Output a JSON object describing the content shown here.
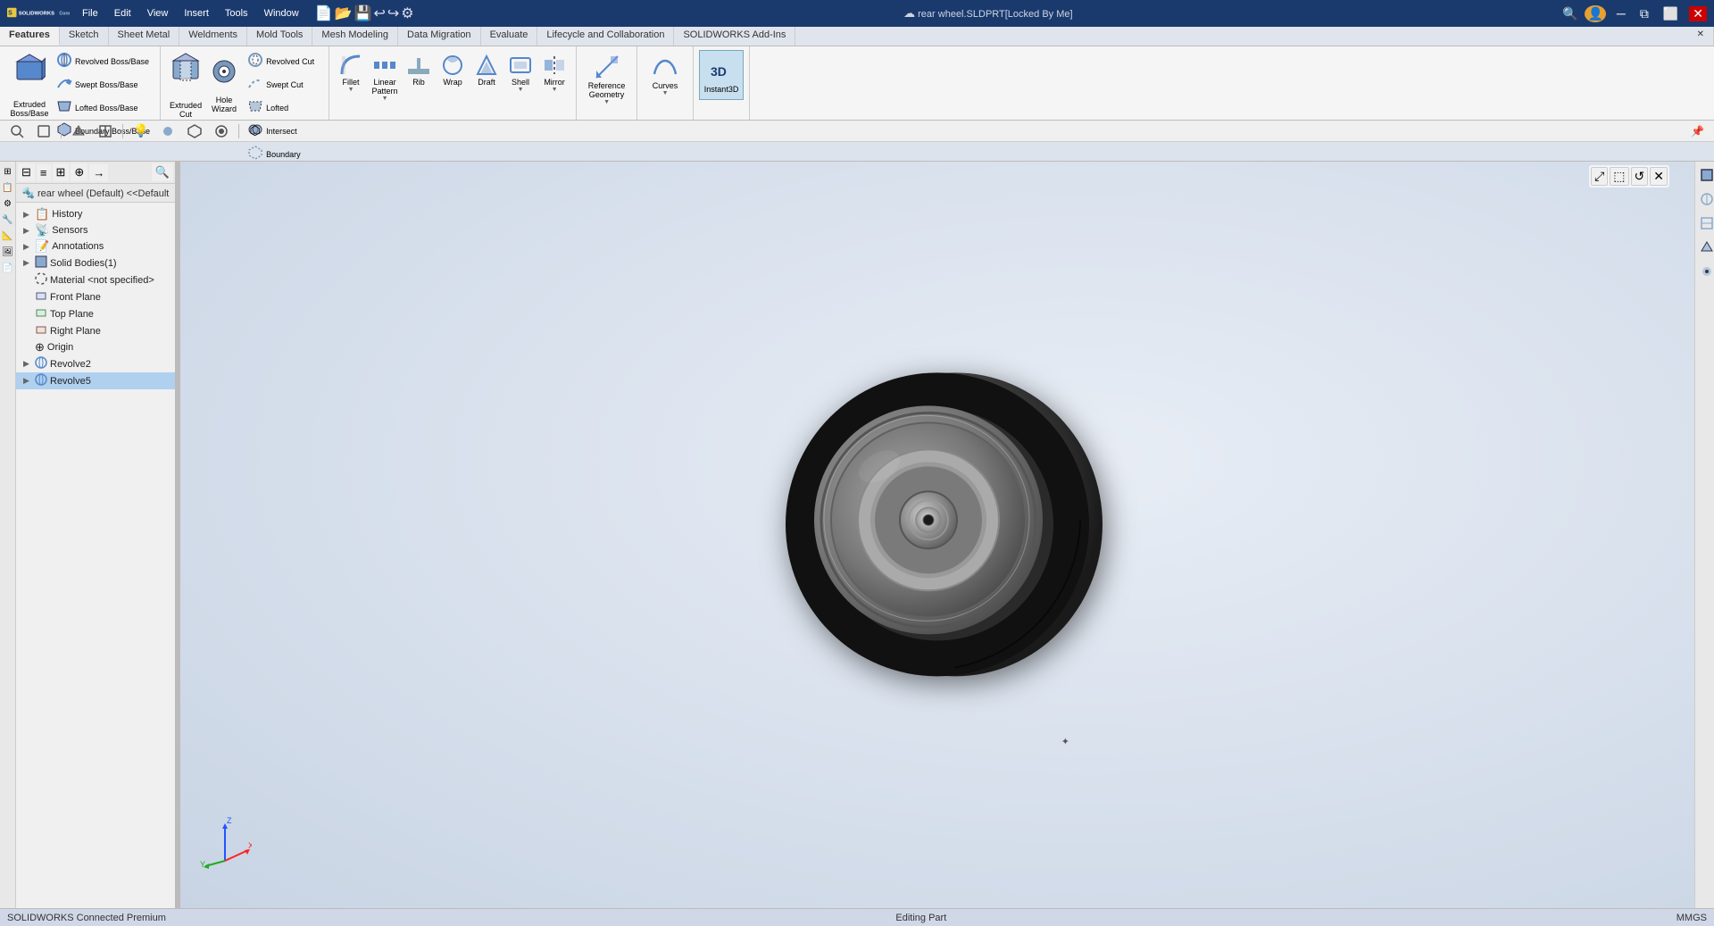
{
  "app": {
    "name": "SOLIDWORKS Connected",
    "version": "Premium",
    "title": "rear wheel.SLDPRT[Locked By Me]",
    "status_left": "SOLIDWORKS Connected Premium",
    "status_right": "Editing Part",
    "status_units": "MMGS"
  },
  "titlebar": {
    "logo": "S",
    "menus": [
      "File",
      "Edit",
      "View",
      "Insert",
      "Tools",
      "Window"
    ],
    "cloud_icon": "☁",
    "user_icon": "👤",
    "help_icon": "?"
  },
  "ribbon": {
    "tabs": [
      "Features",
      "Sketch",
      "Sheet Metal",
      "Weldments",
      "Mold Tools",
      "Mesh Modeling",
      "Data Migration",
      "Evaluate",
      "Lifecycle and Collaboration",
      "SOLIDWORKS Add-Ins"
    ],
    "active_tab": "Features",
    "groups": {
      "boss_base": {
        "items": [
          {
            "label": "Extruded\nBoss/Base",
            "icon": "⬛"
          },
          {
            "label": "Revolved\nBoss/Base",
            "icon": "🔄"
          },
          {
            "label": "Swept Boss/Base",
            "icon": "↗"
          },
          {
            "label": "Lofted Boss/Base",
            "icon": "◆"
          },
          {
            "label": "Boundary Boss/Base",
            "icon": "⬡"
          }
        ]
      },
      "cut": {
        "items": [
          {
            "label": "Extruded\nCut",
            "icon": "⬜"
          },
          {
            "label": "Hole\nWizard",
            "icon": "◎"
          },
          {
            "label": "Revolved\nCut",
            "icon": "🔁"
          },
          {
            "label": "Swept Cut",
            "icon": "↗"
          },
          {
            "label": "Lofted\nCut",
            "icon": "◈"
          },
          {
            "label": "Intersect",
            "icon": "⊕"
          },
          {
            "label": "Boundary\nCut",
            "icon": "⬡"
          }
        ]
      },
      "features": {
        "items": [
          {
            "label": "Fillet",
            "icon": "⌒"
          },
          {
            "label": "Linear\nPattern",
            "icon": "▦"
          },
          {
            "label": "Rib",
            "icon": "▬"
          },
          {
            "label": "Wrap",
            "icon": "↺"
          },
          {
            "label": "Draft",
            "icon": "◁"
          },
          {
            "label": "Shell",
            "icon": "▢"
          },
          {
            "label": "Mirror",
            "icon": "⟺"
          }
        ]
      },
      "reference": {
        "items": [
          {
            "label": "Reference\nGeometry",
            "icon": "📐"
          }
        ]
      },
      "curves": {
        "items": [
          {
            "label": "Curves",
            "icon": "〜"
          }
        ]
      },
      "instant3d": {
        "items": [
          {
            "label": "Instant3D",
            "icon": "3D",
            "active": true
          }
        ]
      }
    }
  },
  "second_toolbar": {
    "icons": [
      "🔍",
      "🎯",
      "🖱",
      "📐",
      "⬚",
      "⬜",
      "🔆",
      "⚙",
      "🔵",
      "⬡",
      "🔲",
      "⭕"
    ]
  },
  "panel": {
    "header_icons": [
      "⊞",
      "≡",
      "⊟",
      "⊕",
      "→"
    ],
    "title": "rear wheel (Default) <<Default",
    "tree": [
      {
        "label": "History",
        "icon": "📋",
        "level": 0,
        "expandable": true
      },
      {
        "label": "Sensors",
        "icon": "📡",
        "level": 0,
        "expandable": true
      },
      {
        "label": "Annotations",
        "icon": "📝",
        "level": 0,
        "expandable": true
      },
      {
        "label": "Solid Bodies(1)",
        "icon": "⬛",
        "level": 0,
        "expandable": true
      },
      {
        "label": "Material <not specified>",
        "icon": "🔲",
        "level": 0,
        "expandable": false
      },
      {
        "label": "Front Plane",
        "icon": "▭",
        "level": 0,
        "expandable": false
      },
      {
        "label": "Top Plane",
        "icon": "▭",
        "level": 0,
        "expandable": false
      },
      {
        "label": "Right Plane",
        "icon": "▭",
        "level": 0,
        "expandable": false
      },
      {
        "label": "Origin",
        "icon": "⊕",
        "level": 0,
        "expandable": false
      },
      {
        "label": "Revolve2",
        "icon": "🔄",
        "level": 0,
        "expandable": true
      },
      {
        "label": "Revolve5",
        "icon": "🔄",
        "level": 0,
        "expandable": true,
        "selected": true
      }
    ]
  },
  "viewport": {
    "bg_color_start": "#e8edf5",
    "bg_color_end": "#c8d4e4"
  },
  "statusbar": {
    "left": "SOLIDWORKS Connected Premium",
    "middle": "Editing Part",
    "right": "MMGS"
  }
}
